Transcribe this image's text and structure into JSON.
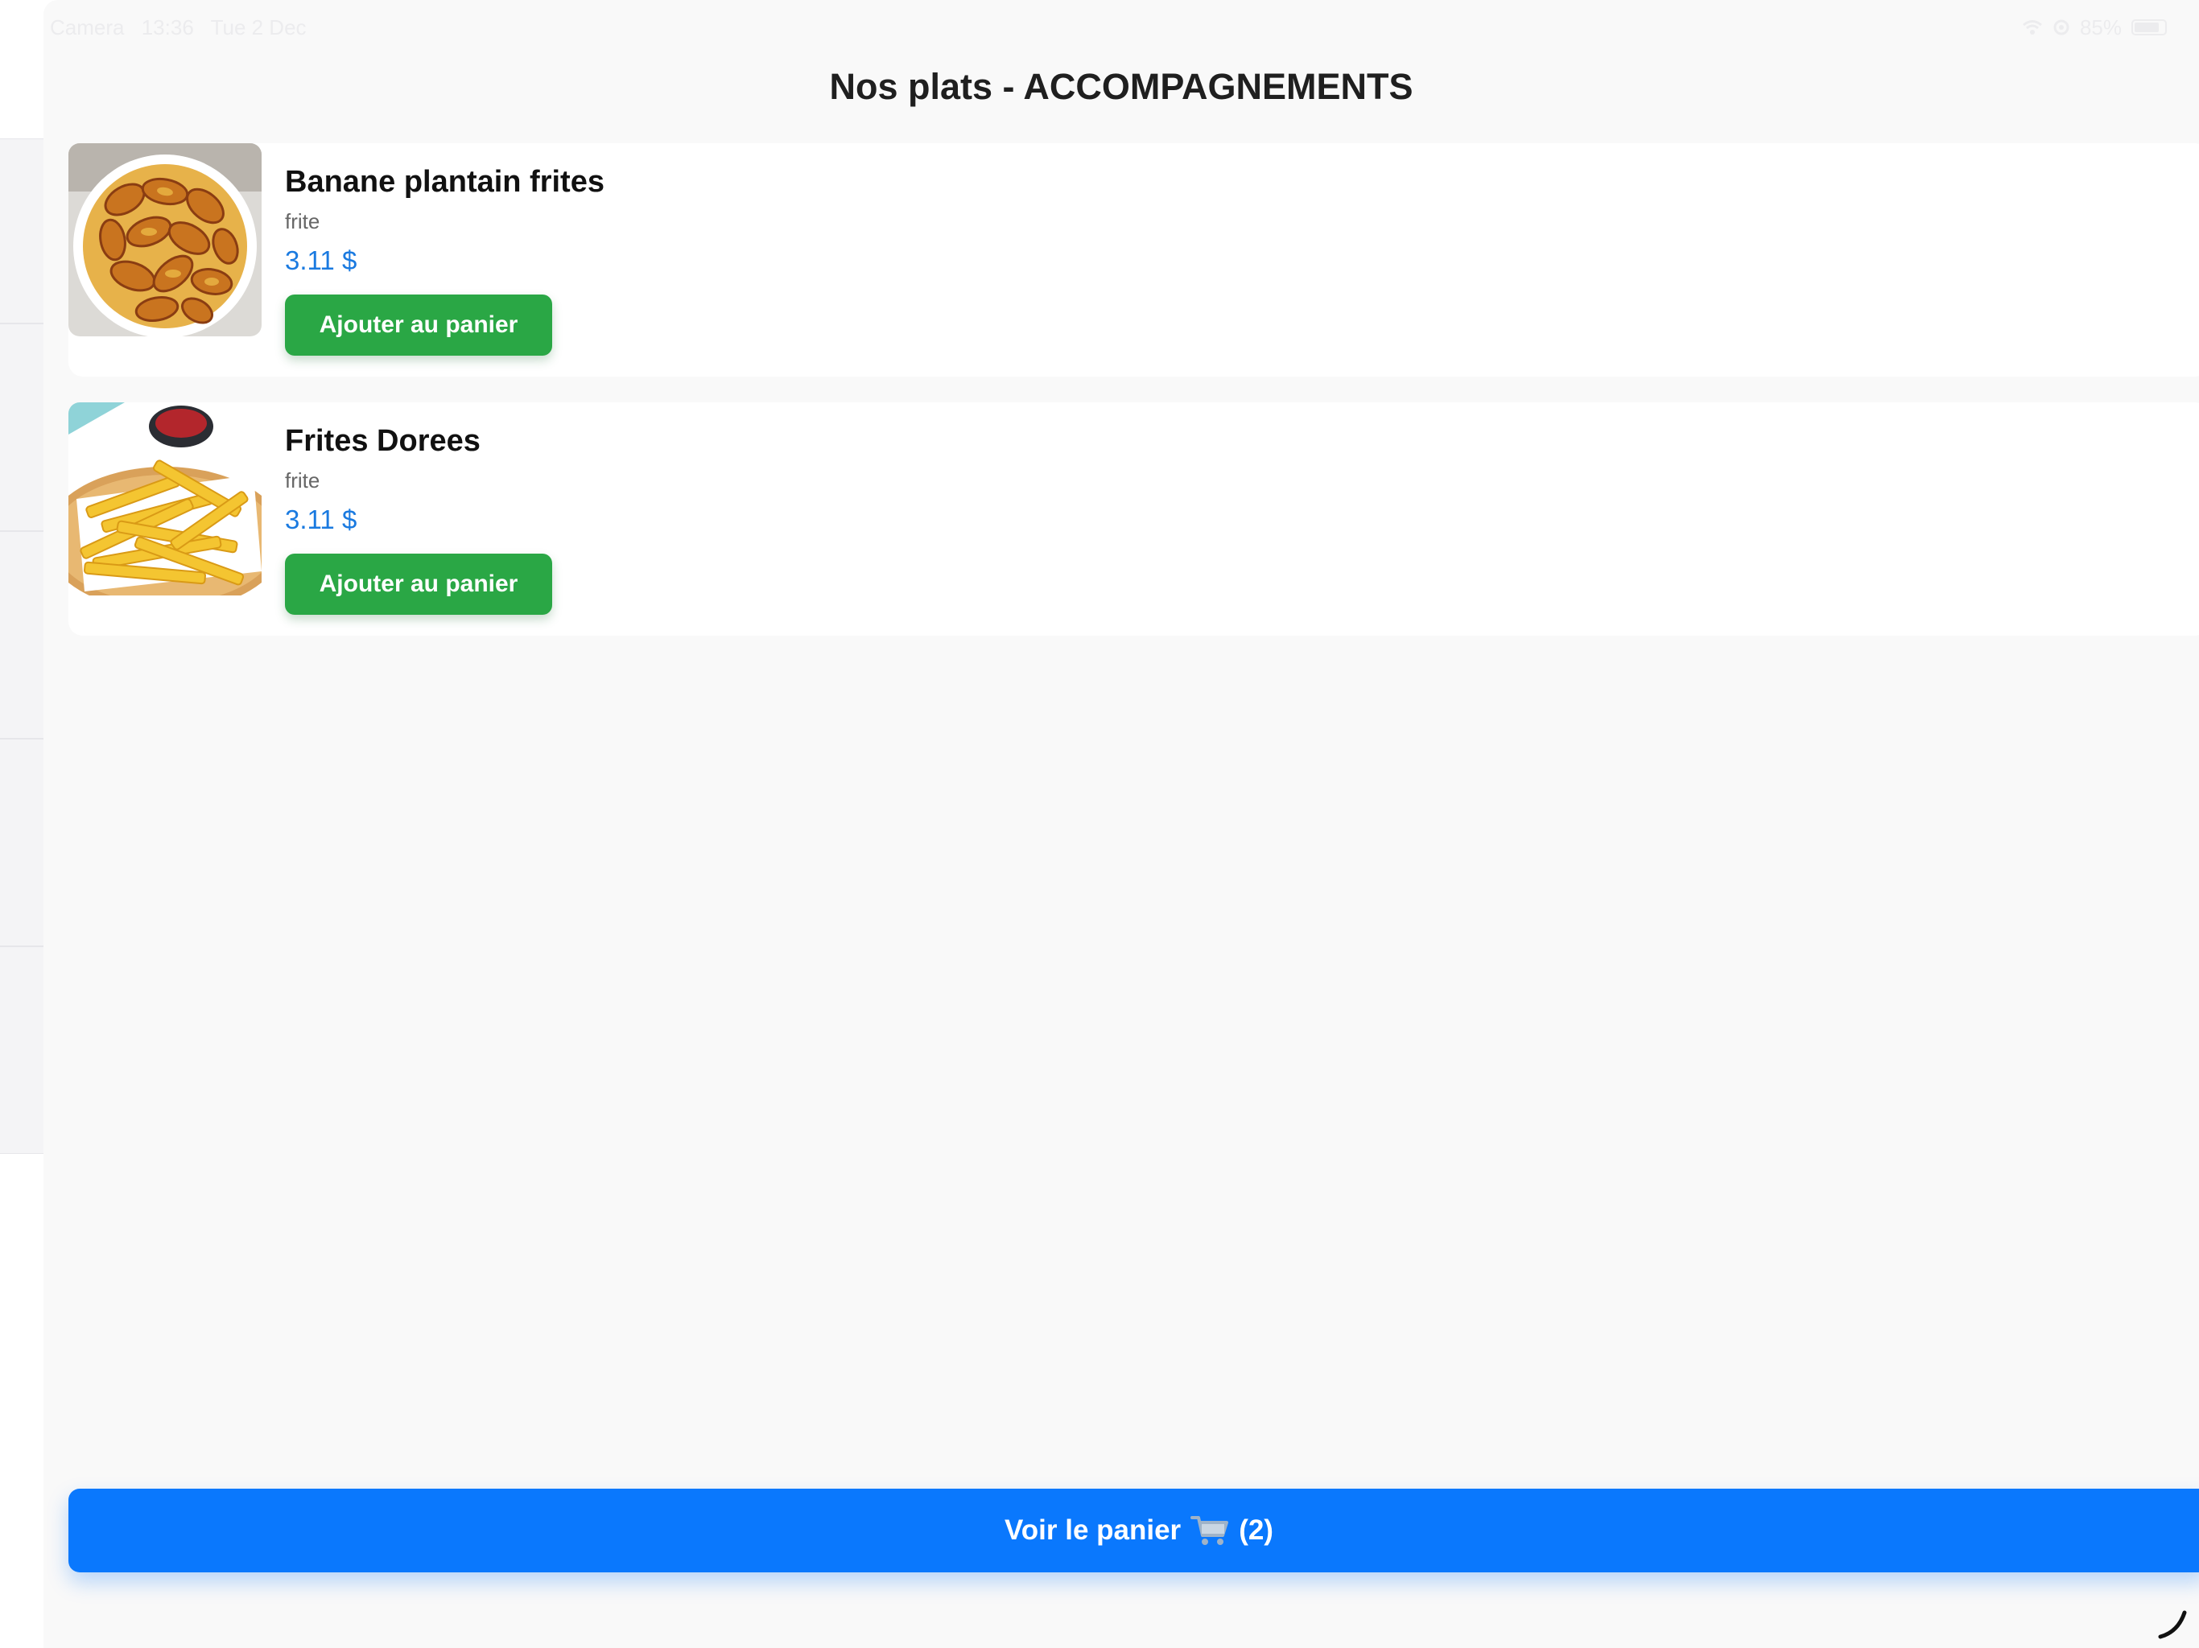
{
  "status_bar": {
    "app": "Camera",
    "time": "13:36",
    "date": "Tue 2 Dec",
    "battery": "85%",
    "icons": [
      "wifi-icon",
      "location-icon",
      "battery-icon"
    ]
  },
  "page": {
    "title": "Nos plats - ACCOMPAGNEMENTS"
  },
  "products": [
    {
      "name": "Banane plantain frites",
      "description": "frite",
      "price": "3.11 $",
      "add_label": "Ajouter au panier",
      "image": "fried-plantain-photo"
    },
    {
      "name": "Frites Dorees",
      "description": "frite",
      "price": "3.11 $",
      "add_label": "Ajouter au panier",
      "image": "french-fries-photo"
    }
  ],
  "cart": {
    "label": "Voir le panier",
    "count": "(2)",
    "icon": "shopping-cart-icon"
  },
  "colors": {
    "accent_blue": "#0a78fd",
    "price_blue": "#1a7ae0",
    "add_green": "#2aa745",
    "sheet_bg": "#f9f9f9"
  }
}
